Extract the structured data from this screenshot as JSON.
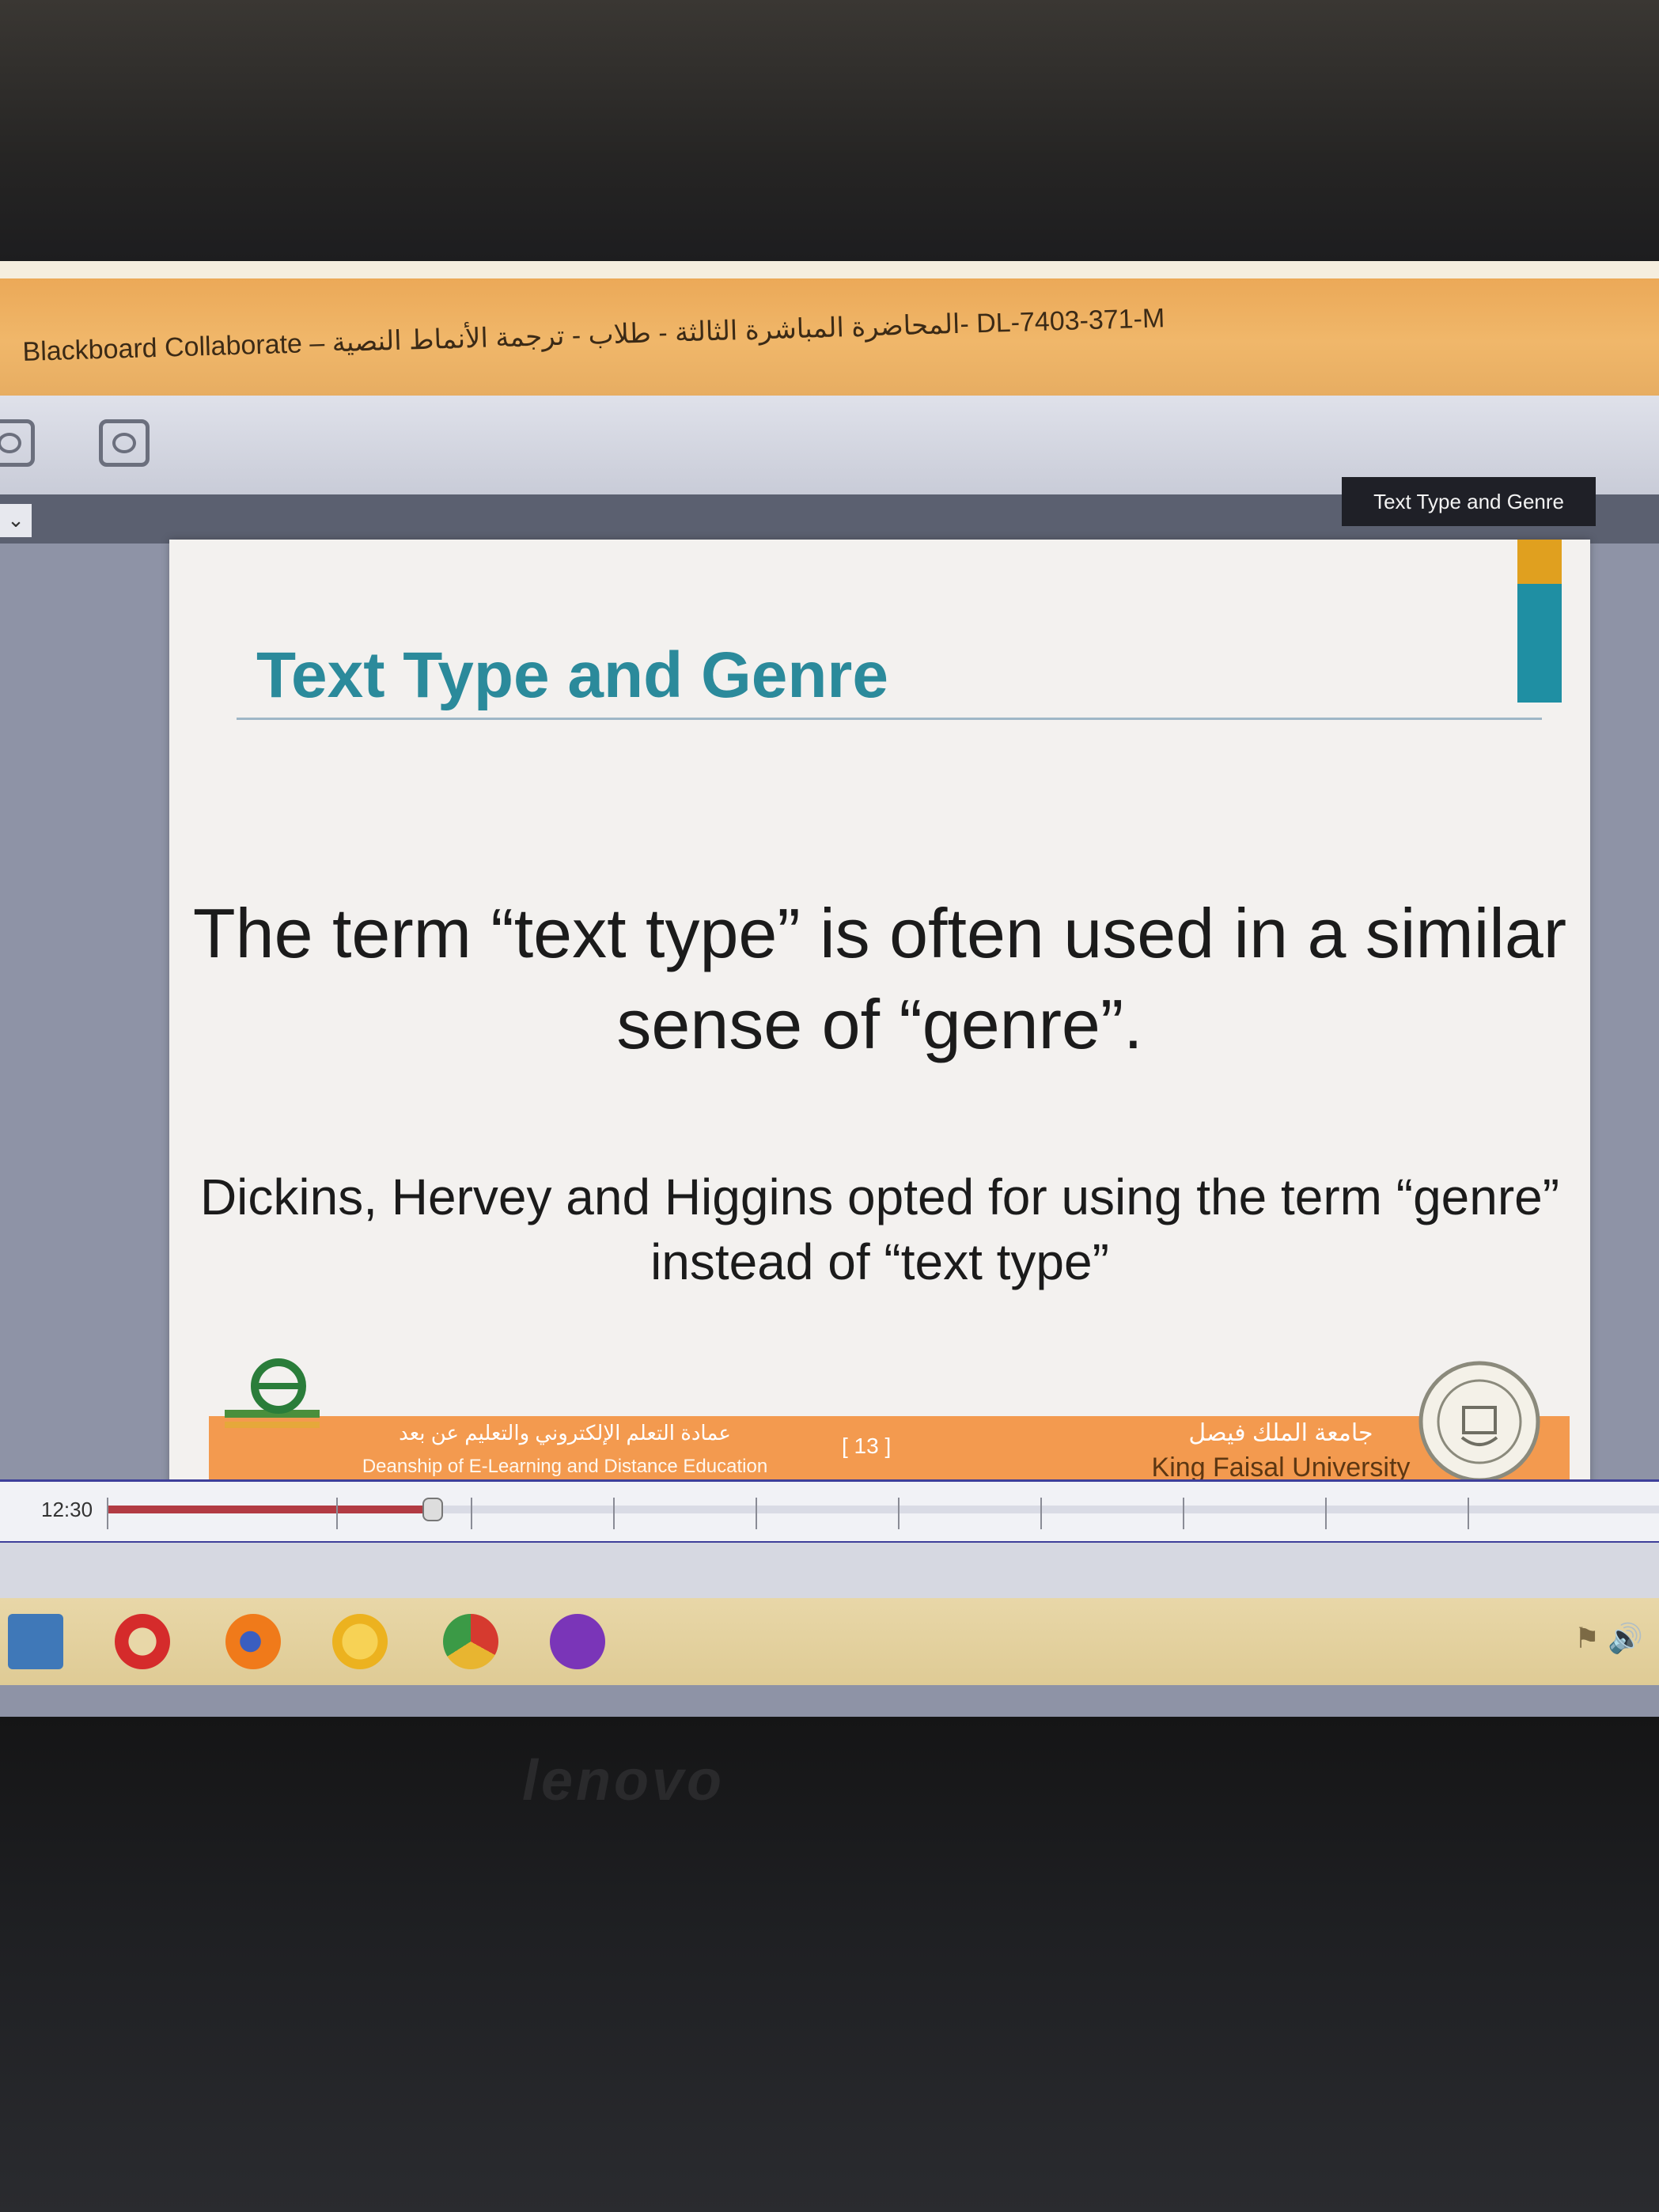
{
  "window": {
    "title": "Blackboard Collaborate – المحاضرة المباشرة الثالثة - طلاب - ترجمة الأنماط النصية- DL-7403-371-M"
  },
  "slide_tab": {
    "label": "Text Type and Genre"
  },
  "slide": {
    "heading": "Text Type and Genre",
    "main_text": "The term “text type” is often used in a similar sense of “genre”.",
    "sub_text": "Dickins, Hervey and Higgins opted for using the term “genre” instead of “text type”",
    "footer": {
      "deanship_ar": "عمادة التعلم الإلكتروني والتعليم عن بعد",
      "deanship_en": "Deanship of E-Learning and Distance Education",
      "page": "[ 13 ]",
      "university_ar": "جامعة الملك فيصل",
      "university_en": "King Faisal University"
    }
  },
  "timeline": {
    "time": "12:30",
    "progress_fraction": 0.21
  },
  "taskbar": {
    "icons": [
      "blackboard-icon",
      "opera-icon",
      "firefox-icon",
      "messenger-icon",
      "chrome-icon",
      "collaborate-icon"
    ]
  },
  "bezel": {
    "brand": "lenovo"
  },
  "colors": {
    "title_bar": "#eaa553",
    "slide_heading": "#2b8a9b",
    "slide_footer": "#f39a4f",
    "accent_gold": "#e0a01f",
    "accent_teal": "#1f8fa3",
    "timeline_fill": "#b23b43"
  }
}
